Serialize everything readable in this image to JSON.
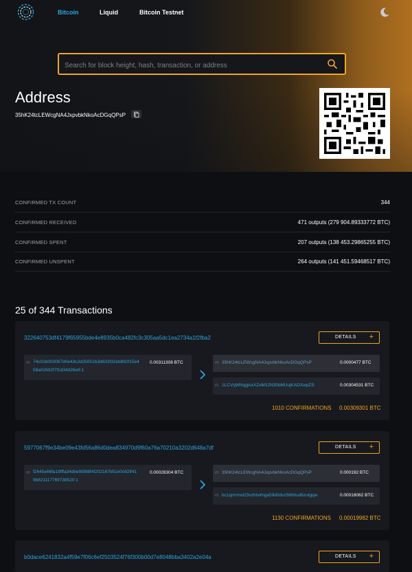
{
  "nav": {
    "items": [
      {
        "label": "Bitcoin",
        "active": true
      },
      {
        "label": "Liquid",
        "active": false
      },
      {
        "label": "Bitcoin Testnet",
        "active": false
      }
    ]
  },
  "search": {
    "placeholder": "Search for block height, hash, transaction, or address"
  },
  "address": {
    "title": "Address",
    "hash": "35hK24tcLEWcgNA4JxpvbkNkoAcDGqQPsP"
  },
  "stats": [
    {
      "label": "CONFIRMED TX COUNT",
      "value": "344"
    },
    {
      "label": "CONFIRMED RECEIVED",
      "value": "471 outputs (279 904.89333772 BTC)"
    },
    {
      "label": "CONFIRMED SPENT",
      "value": "207 outputs (138 453.29865255 BTC)"
    },
    {
      "label": "CONFIRMED UNSPENT",
      "value": "264 outputs (141 451.59468517 BTC)"
    }
  ],
  "transactions_heading": "25 of 344 Transactions",
  "details_label": "DETAILS",
  "transactions": [
    {
      "txid": "322640753df4179f65955bde4e8935b0ca482fc3c305aa5dc1ea2734a1f2fba2",
      "input": {
        "index": "#0",
        "line1": "74c01b003067d0e43c2d25051b3d633f32eb892f15e4",
        "line2": "58a02602f7f1d34d26e9:1",
        "amount": "0.00311308 BTC"
      },
      "outputs": [
        {
          "index": "#0",
          "address": "35hK24tcLEWcgNA4JxpvbkNkoAcDGqQPsP",
          "amount": "0.0000477 BTC"
        },
        {
          "index": "#1",
          "address": "1LCVqWNqgisxXZvM3JN35bMUujKADXwpZS",
          "amount": "0.00304531 BTC"
        }
      ],
      "confirmations": "1010 CONFIRMATIONS",
      "total": "0.00309301 BTC"
    },
    {
      "txid": "5977067f9e34be09e43fd56a86d0dea834970d9f60a76a70210a3202d648a7df",
      "input": {
        "index": "#0",
        "line1": "f2645e66fa19fffa34dbe95f88f4f202167b51e0c62ff41",
        "line2": "9b821117769738520:1",
        "amount": "0.00028304 BTC"
      },
      "outputs": [
        {
          "index": "#0",
          "address": "35hK24tcLEWcgNA4JxpvbkNkoAcDGqQPsP",
          "amount": "0.000192 BTC"
        },
        {
          "index": "#1",
          "address": "bc1qmrmvt23xzhtslrhga59d0dvz58thtud6zutgqw",
          "amount": "0.00018062 BTC"
        }
      ],
      "confirmations": "1130 CONFIRMATIONS",
      "total": "0.00019982 BTC"
    },
    {
      "txid": "b0dace6241832a4f59e7f06c6ef2503524f76f300b00d7e8048bba3402a2e04a"
    }
  ]
}
